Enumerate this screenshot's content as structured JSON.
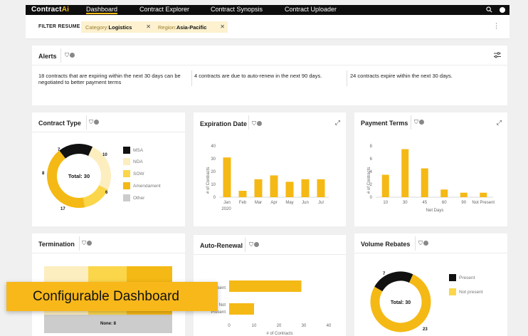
{
  "app": {
    "logo_main": "Contract",
    "logo_accent": "Ai",
    "nav": [
      "Dashboard",
      "Contract Explorer",
      "Contract Synopsis",
      "Contract Uploader"
    ]
  },
  "filter": {
    "label": "FILTER RESUME",
    "chips": [
      {
        "key": "Category:",
        "value": "Logistics"
      },
      {
        "key": "Region:",
        "value": "Asia-Pacific"
      }
    ]
  },
  "alerts": {
    "title": "Alerts",
    "items": [
      "18 contracts that are expiring within the next 30 days can be negotiated to better payment terms",
      "4 contracts are due to auto-renew in the next 90 days.",
      "24 contracts expire within the next 30 days."
    ]
  },
  "cards": {
    "contract_type": "Contract Type",
    "expiration_date": "Expiration Date",
    "payment_terms": "Payment Terms",
    "termination": "Termination",
    "auto_renewal": "Auto-Renewal",
    "volume_rebates": "Volume Rebates"
  },
  "colors": {
    "accent": "#f5b915",
    "dark": "#111111",
    "light_yellow": "#fdeec0",
    "mid_yellow": "#fbd64a",
    "grey": "#cccccc"
  },
  "chart_data": [
    {
      "type": "pie",
      "title": "Contract Type",
      "center_label": "Total: 30",
      "categories": [
        "MSA",
        "NDA",
        "SOW",
        "Amendament",
        "Other"
      ],
      "values": [
        7,
        10,
        6,
        17,
        0
      ],
      "slice_labels": [
        "7",
        "10",
        "6",
        "17",
        "8"
      ]
    },
    {
      "type": "bar",
      "title": "Expiration Date",
      "categories": [
        "Jan",
        "Feb",
        "Mar",
        "Apr",
        "May",
        "Jun",
        "Jul"
      ],
      "year_label": "2020",
      "values": [
        31,
        5,
        14,
        17,
        12,
        14,
        14
      ],
      "ylabel": "# of Contracts",
      "ylim": [
        0,
        40
      ],
      "yticks": [
        0,
        10,
        20,
        30,
        40
      ]
    },
    {
      "type": "bar",
      "title": "Payment Terms",
      "categories": [
        "10",
        "30",
        "45",
        "60",
        "90",
        "Not Present"
      ],
      "values": [
        3.5,
        7.5,
        4.5,
        1.2,
        0.7,
        0.7
      ],
      "ylabel": "# of Contracts",
      "xlabel": "Net Days",
      "ylim": [
        0,
        8
      ],
      "yticks": [
        0,
        2,
        4,
        6,
        8
      ]
    },
    {
      "type": "heatmap",
      "title": "Termination",
      "visible_label": "None: 8"
    },
    {
      "type": "bar",
      "title": "Auto-Renewal",
      "categories": [
        "Present",
        "Not Present"
      ],
      "visible_category_text": [
        "sent",
        "Not",
        "Present"
      ],
      "values": [
        29,
        10
      ],
      "xlabel": "# of Contracts",
      "xlim": [
        0,
        40
      ],
      "xticks": [
        0,
        10,
        20,
        30,
        40
      ]
    },
    {
      "type": "pie",
      "title": "Volume Rebates",
      "center_label": "Total: 30",
      "categories": [
        "Present",
        "Not present"
      ],
      "values": [
        7,
        23
      ],
      "slice_labels": [
        "7",
        "23"
      ]
    }
  ],
  "banner": "Configurable Dashboard"
}
